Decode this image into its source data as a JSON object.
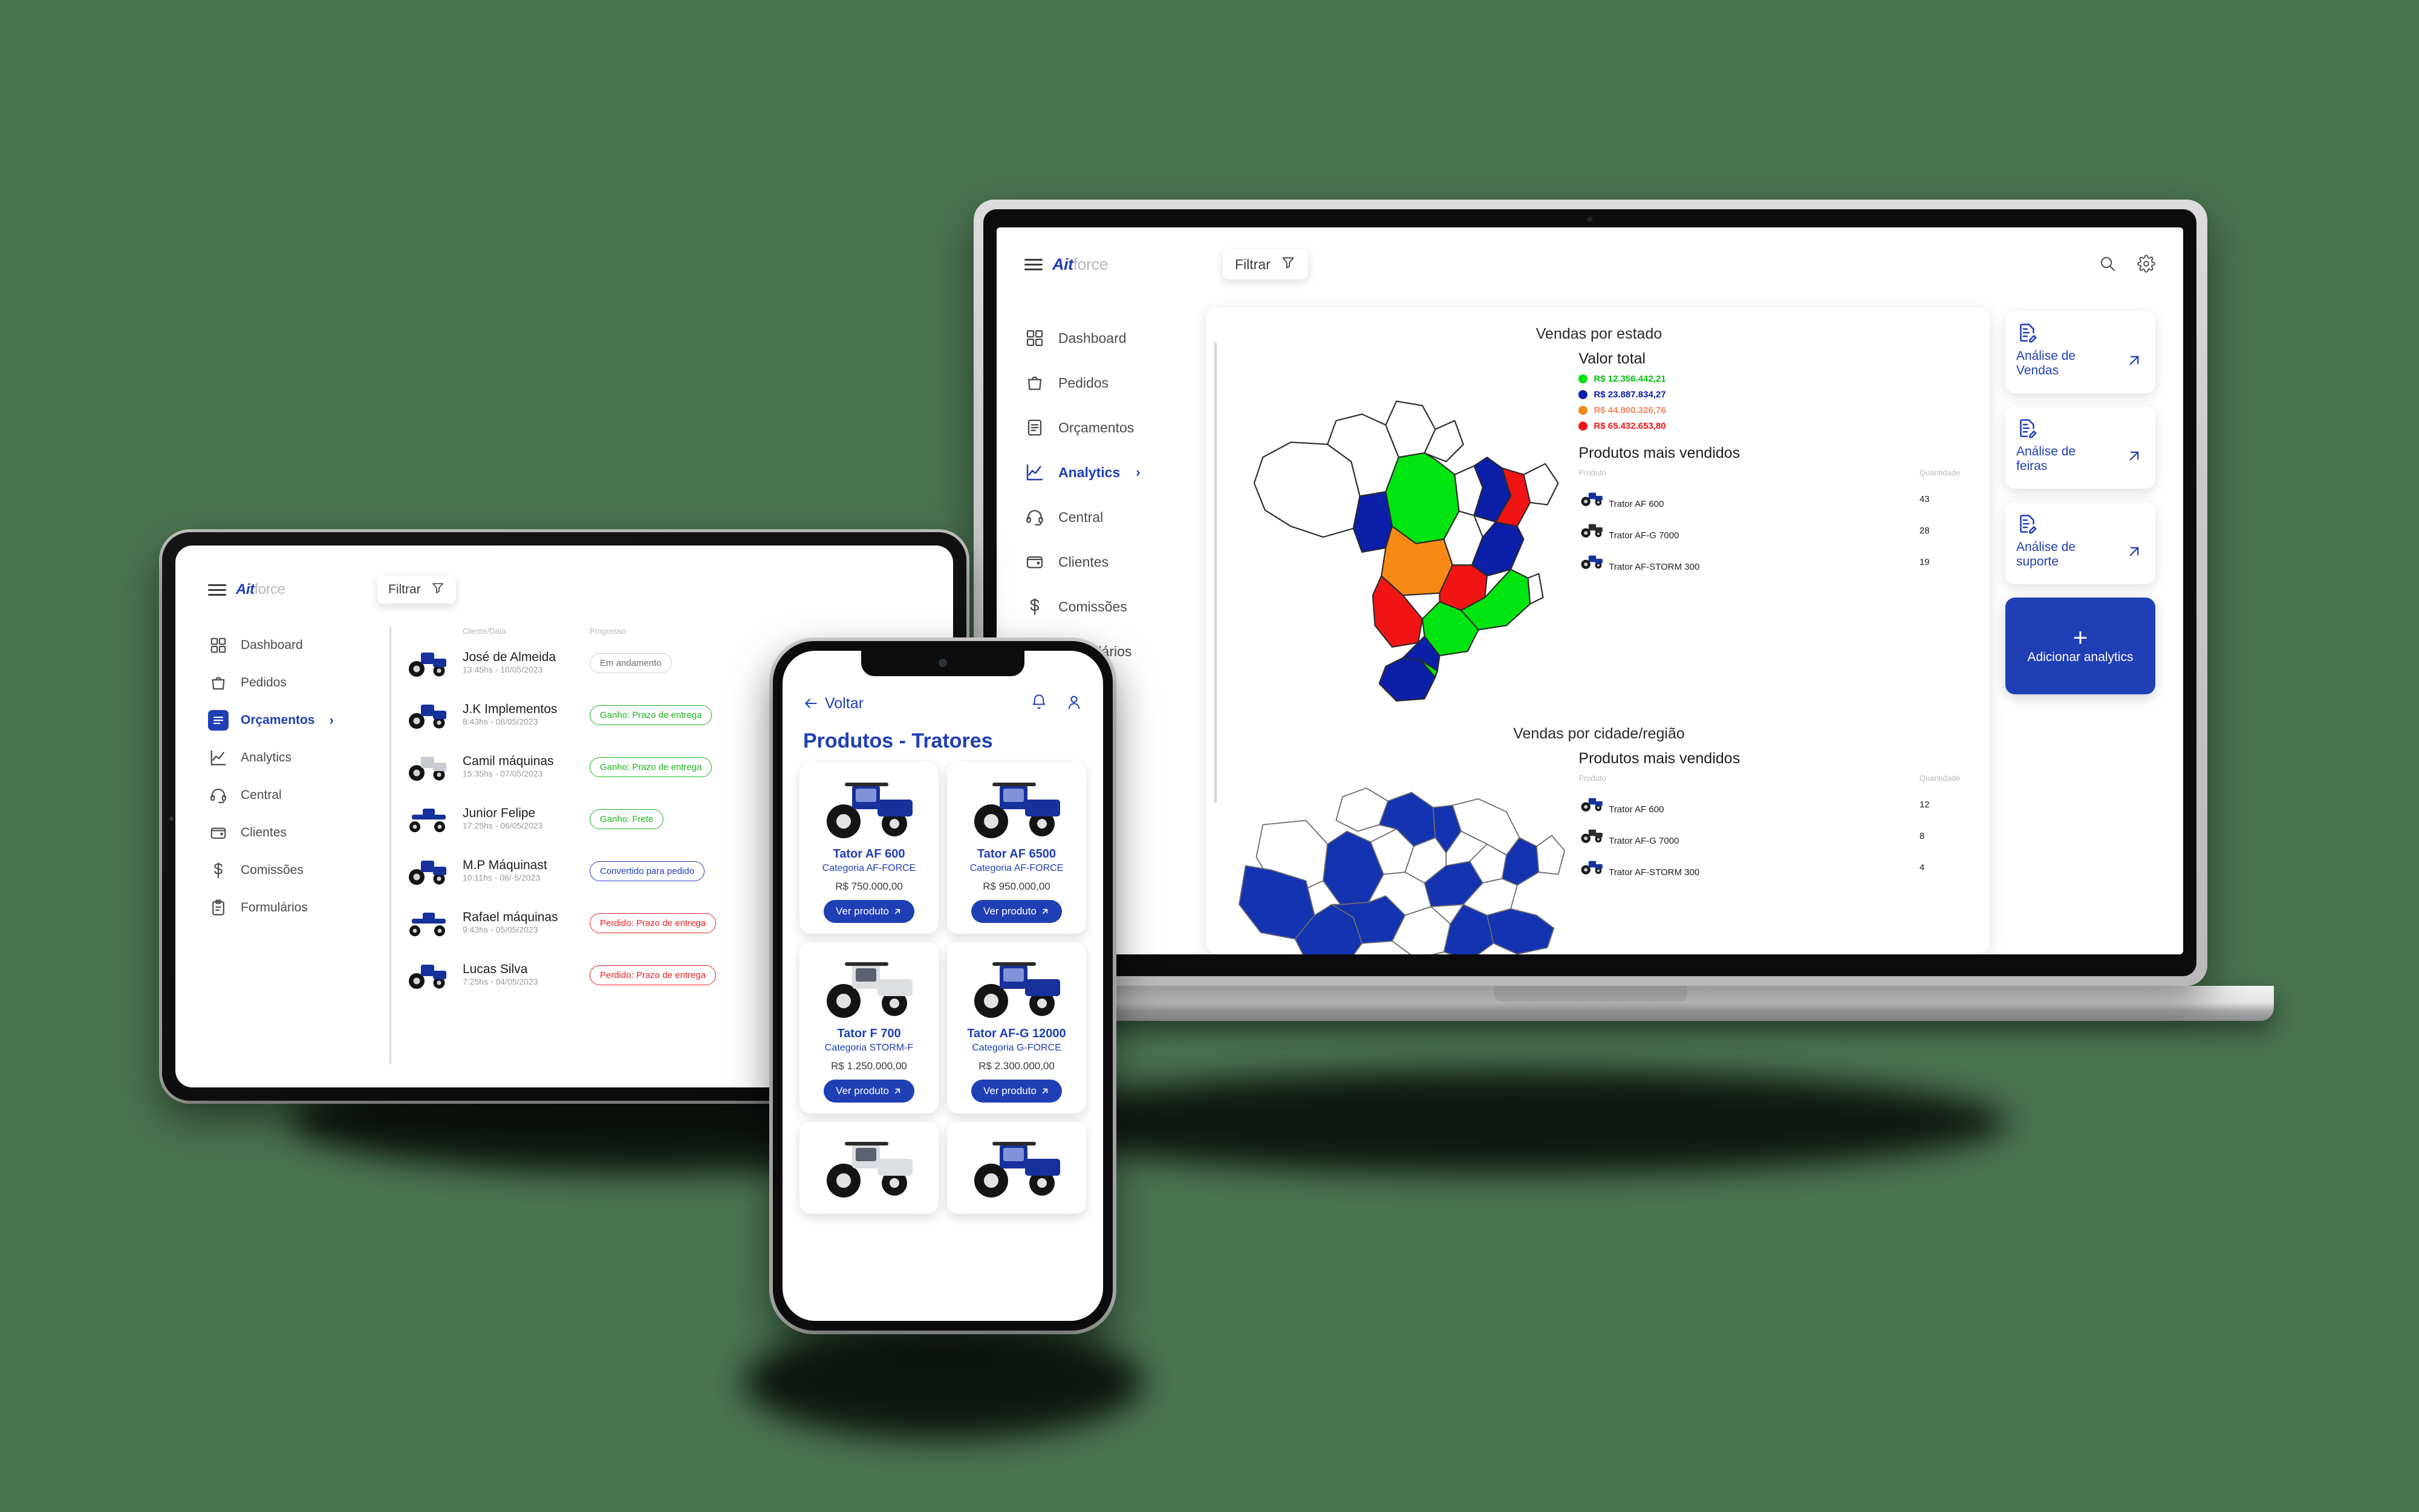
{
  "background_color": "#4a7350",
  "brand": {
    "mark": "Ait",
    "suffix": "force"
  },
  "laptop": {
    "topbar": {
      "filter_label": "Filtrar",
      "search_icon": "search-icon",
      "settings_icon": "gear-icon"
    },
    "sidebar": {
      "items": [
        {
          "label": "Dashboard",
          "icon": "grid-icon",
          "active": false
        },
        {
          "label": "Pedidos",
          "icon": "bag-icon",
          "active": false
        },
        {
          "label": "Orçamentos",
          "icon": "document-icon",
          "active": false
        },
        {
          "label": "Analytics",
          "icon": "chart-line-icon",
          "active": true
        },
        {
          "label": "Central",
          "icon": "headset-icon",
          "active": false
        },
        {
          "label": "Clientes",
          "icon": "wallet-icon",
          "active": false
        },
        {
          "label": "Comissões",
          "icon": "dollar-icon",
          "active": false
        },
        {
          "label": "Formulários",
          "icon": "clipboard-icon",
          "active": false
        }
      ]
    },
    "sections": [
      {
        "title": "Vendas por estado",
        "map": "brazil-states-map",
        "valor_total_title": "Valor total",
        "legend": [
          {
            "color": "#00e510",
            "value": "R$ 12.356.442,21"
          },
          {
            "color": "#0b1fa8",
            "value": "R$ 23.887.834,27"
          },
          {
            "color": "#f78a16",
            "value": "R$ 44.800.326,76"
          },
          {
            "color": "#f01414",
            "value": "R$ 65.432.653,80"
          }
        ],
        "products_title": "Produtos mais vendidos",
        "columns": [
          "Produto",
          "Quantidade"
        ],
        "rows": [
          {
            "product": "Trator AF 600",
            "qty": "43"
          },
          {
            "product": "Trator AF-G 7000",
            "qty": "28"
          },
          {
            "product": "Trator AF-STORM 300",
            "qty": "19"
          }
        ]
      },
      {
        "title": "Vendas por cidade/região",
        "map": "parana-region-map",
        "products_title": "Produtos mais vendidos",
        "columns": [
          "Produto",
          "Quantidade"
        ],
        "rows": [
          {
            "product": "Trator AF 600",
            "qty": "12"
          },
          {
            "product": "Trator AF-G 7000",
            "qty": "8"
          },
          {
            "product": "Trator AF-STORM 300",
            "qty": "4"
          }
        ]
      }
    ],
    "action_cards": [
      {
        "label": "Análise de Vendas",
        "icon": "document-edit-icon",
        "arrow": "arrow-up-right-icon"
      },
      {
        "label": "Análise de feiras",
        "icon": "document-edit-icon",
        "arrow": "arrow-up-right-icon"
      },
      {
        "label": "Análise de suporte",
        "icon": "document-edit-icon",
        "arrow": "arrow-up-right-icon"
      }
    ],
    "add_button": {
      "label": "Adicionar analytics",
      "plus": "+"
    }
  },
  "tablet": {
    "topbar": {
      "filter_label": "Filtrar"
    },
    "sidebar": {
      "items": [
        {
          "label": "Dashboard",
          "icon": "grid-icon",
          "active": false
        },
        {
          "label": "Pedidos",
          "icon": "bag-icon",
          "active": false
        },
        {
          "label": "Orçamentos",
          "icon": "document-icon",
          "active": true
        },
        {
          "label": "Analytics",
          "icon": "chart-line-icon",
          "active": false
        },
        {
          "label": "Central",
          "icon": "headset-icon",
          "active": false
        },
        {
          "label": "Clientes",
          "icon": "wallet-icon",
          "active": false
        },
        {
          "label": "Comissões",
          "icon": "dollar-icon",
          "active": false
        },
        {
          "label": "Formulários",
          "icon": "clipboard-icon",
          "active": false
        }
      ]
    },
    "list": {
      "columns": [
        "Cliente/Data",
        "Progresso"
      ],
      "rows": [
        {
          "name": "José de Almeida",
          "date": "13:45hs - 10/05/2023",
          "status": "Em andamento",
          "tone": ""
        },
        {
          "name": "J.K Implementos",
          "date": "8:43hs - 08/05/2023",
          "status": "Ganho: Prazo de entrega",
          "tone": "green"
        },
        {
          "name": "Camil máquinas",
          "date": "15:35hs - 07/05/2023",
          "status": "Ganho: Prazo de entrega",
          "tone": "green"
        },
        {
          "name": "Junior Felipe",
          "date": "17:25hs - 06/05/2023",
          "status": "Ganho: Frete",
          "tone": "green"
        },
        {
          "name": "M.P Máquinast",
          "date": "10:11hs - 06/-5/2023",
          "status": "Convertido para pedido",
          "tone": "blue"
        },
        {
          "name": "Rafael máquinas",
          "date": "9:43hs - 05/05/2023",
          "status": "Perdido: Prazo de entrega",
          "tone": "red"
        },
        {
          "name": "Lucas Silva",
          "date": "7:25hs - 04/05/2023",
          "status": "Perdido: Prazo de entrega",
          "tone": "red"
        }
      ]
    }
  },
  "phone": {
    "back_label": "Voltar",
    "bell_icon": "bell-icon",
    "profile_icon": "user-icon",
    "title": "Produtos - Tratores",
    "cta_label": "Ver produto",
    "products": [
      {
        "name": "Tator AF 600",
        "category": "Categoria AF-FORCE",
        "price": "R$ 750.000,00",
        "color": "blue"
      },
      {
        "name": "Tator AF 6500",
        "category": "Categoria AF-FORCE",
        "price": "R$ 950.000,00",
        "color": "blue"
      },
      {
        "name": "Tator F 700",
        "category": "Categoria STORM-F",
        "price": "R$ 1.250.000,00",
        "color": "white"
      },
      {
        "name": "Tator AF-G 12000",
        "category": "Categoria G-FORCE",
        "price": "R$ 2.300.000,00",
        "color": "blue"
      }
    ]
  }
}
